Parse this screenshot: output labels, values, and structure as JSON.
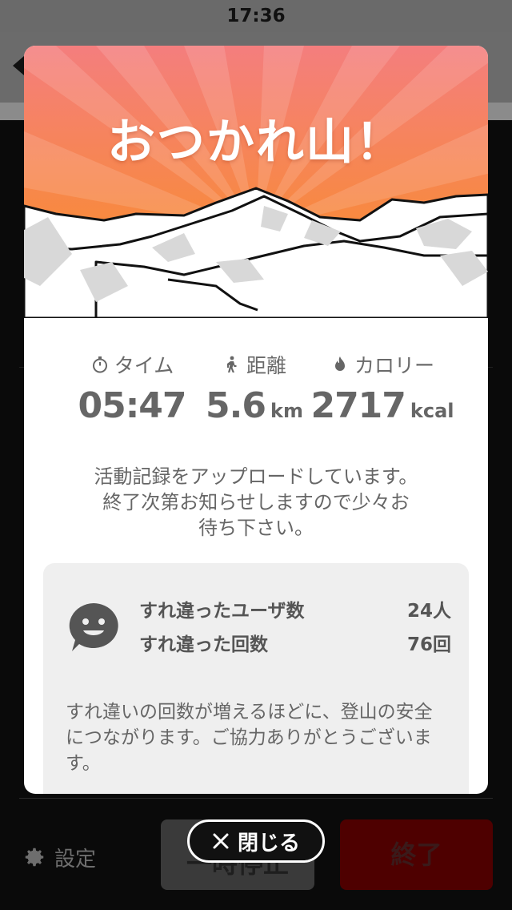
{
  "status_bar": {
    "time": "17:36"
  },
  "modal": {
    "title": "おつかれ山！",
    "stats": {
      "time": {
        "label": "タイム",
        "value": "05:47",
        "unit": ""
      },
      "distance": {
        "label": "距離",
        "value": "5.6",
        "unit": "km"
      },
      "calorie": {
        "label": "カロリー",
        "value": "2717",
        "unit": "kcal"
      }
    },
    "upload_message": "活動記録をアップロードしています。\n終了次第お知らせしますので少々お\n待ち下さい。",
    "encounter": {
      "users_label": "すれ違ったユーザ数",
      "users_value": "24人",
      "count_label": "すれ違った回数",
      "count_value": "76回",
      "note": "すれ違いの回数が増えるほどに、登山の安全につながります。ご協力ありがとうございます。"
    },
    "close_label": "閉じる"
  },
  "background": {
    "settings_label": "設定",
    "pause_label": "一時停止",
    "end_label": "終了"
  },
  "colors": {
    "hero_top": "#f47e7e",
    "hero_bottom": "#f88a3c",
    "end_button": "#4e0000"
  },
  "icons": [
    "back-arrow-icon",
    "stopwatch-icon",
    "hiker-icon",
    "flame-icon",
    "smiley-chat-icon",
    "close-icon",
    "gear-icon"
  ]
}
